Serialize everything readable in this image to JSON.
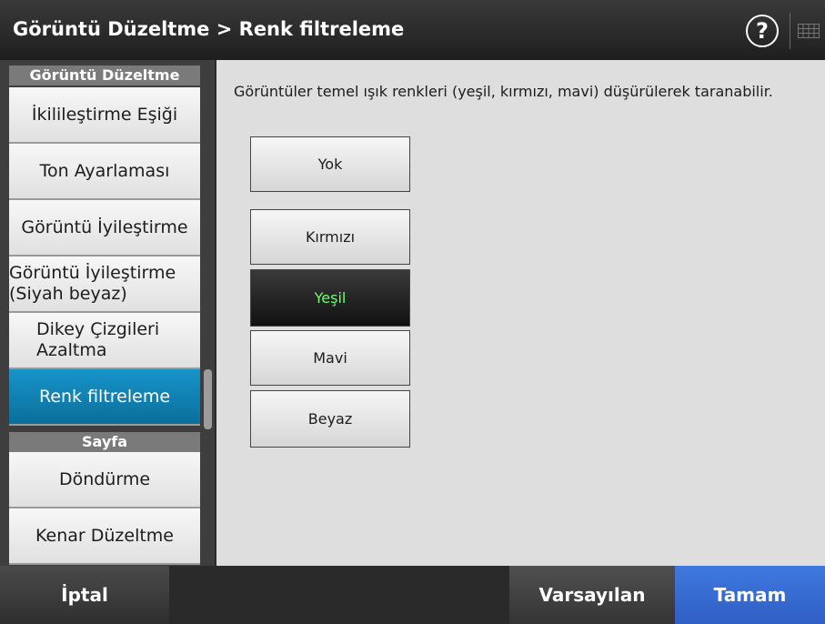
{
  "header": {
    "title": "Görüntü Düzeltme > Renk filtreleme",
    "help_glyph": "?"
  },
  "sidebar": {
    "section1": "Görüntü Düzeltme",
    "items1": [
      {
        "line1": "İkilileştirme Eşiği"
      },
      {
        "line1": "Ton Ayarlaması"
      },
      {
        "line1": "Görüntü İyileştirme"
      },
      {
        "line1": "Görüntü İyileştirme",
        "line2": "(Siyah beyaz)"
      },
      {
        "line1": "Dikey Çizgileri",
        "line2": "Azaltma"
      },
      {
        "line1": "Renk filtreleme"
      }
    ],
    "section2": "Sayfa",
    "items2": [
      {
        "line1": "Döndürme"
      },
      {
        "line1": "Kenar Düzeltme"
      }
    ],
    "active_item": "Renk filtreleme"
  },
  "main": {
    "description": "Görüntüler temel ışık renkleri (yeşil, kırmızı, mavi) düşürülerek taranabilir.",
    "options": [
      "Yok",
      "Kırmızı",
      "Yeşil",
      "Mavi",
      "Beyaz"
    ],
    "selected": "Yeşil"
  },
  "footer": {
    "cancel": "İptal",
    "defaults": "Varsayılan",
    "ok": "Tamam"
  },
  "colors": {
    "accent_ok": "#3a6fd8",
    "active_nav": "#0f7fb0",
    "selected_text": "#6dff6d"
  }
}
